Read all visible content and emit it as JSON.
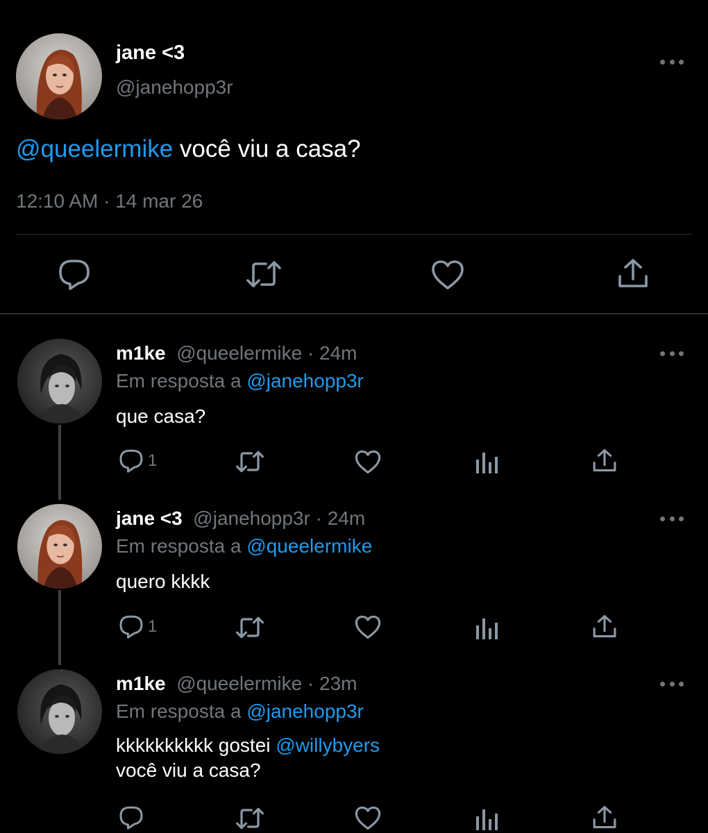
{
  "main_tweet": {
    "name": "jane <3",
    "handle": "@janehopp3r",
    "mention": "@queelermike",
    "text": " você viu a casa?",
    "timestamp": "12:10 AM · 14 mar 26",
    "actions": [
      "reply-icon",
      "retweet-icon",
      "like-icon",
      "share-icon"
    ]
  },
  "replies": [
    {
      "name": "m1ke",
      "meta": "@queelermike · 24m",
      "reply_prefix": "Em resposta a ",
      "reply_to": "@janehopp3r",
      "text": "que casa?",
      "reply_count": "1"
    },
    {
      "name": "jane <3",
      "meta": "@janehopp3r · 24m",
      "reply_prefix": "Em resposta a ",
      "reply_to": "@queelermike",
      "text": "quero kkkk",
      "reply_count": "1"
    },
    {
      "name": "m1ke",
      "meta": "@queelermike · 23m",
      "reply_prefix": "Em resposta a ",
      "reply_to": "@janehopp3r",
      "text_before": "kkkkkkkkkk gostei ",
      "text_mention": "@willybyers",
      "text_line2": "você viu a casa?",
      "reply_count": ""
    }
  ],
  "colors": {
    "background": "#000000",
    "text": "#ffffff",
    "secondary": "#71767b",
    "link": "#1d9bf0",
    "divider": "#2f3336"
  }
}
